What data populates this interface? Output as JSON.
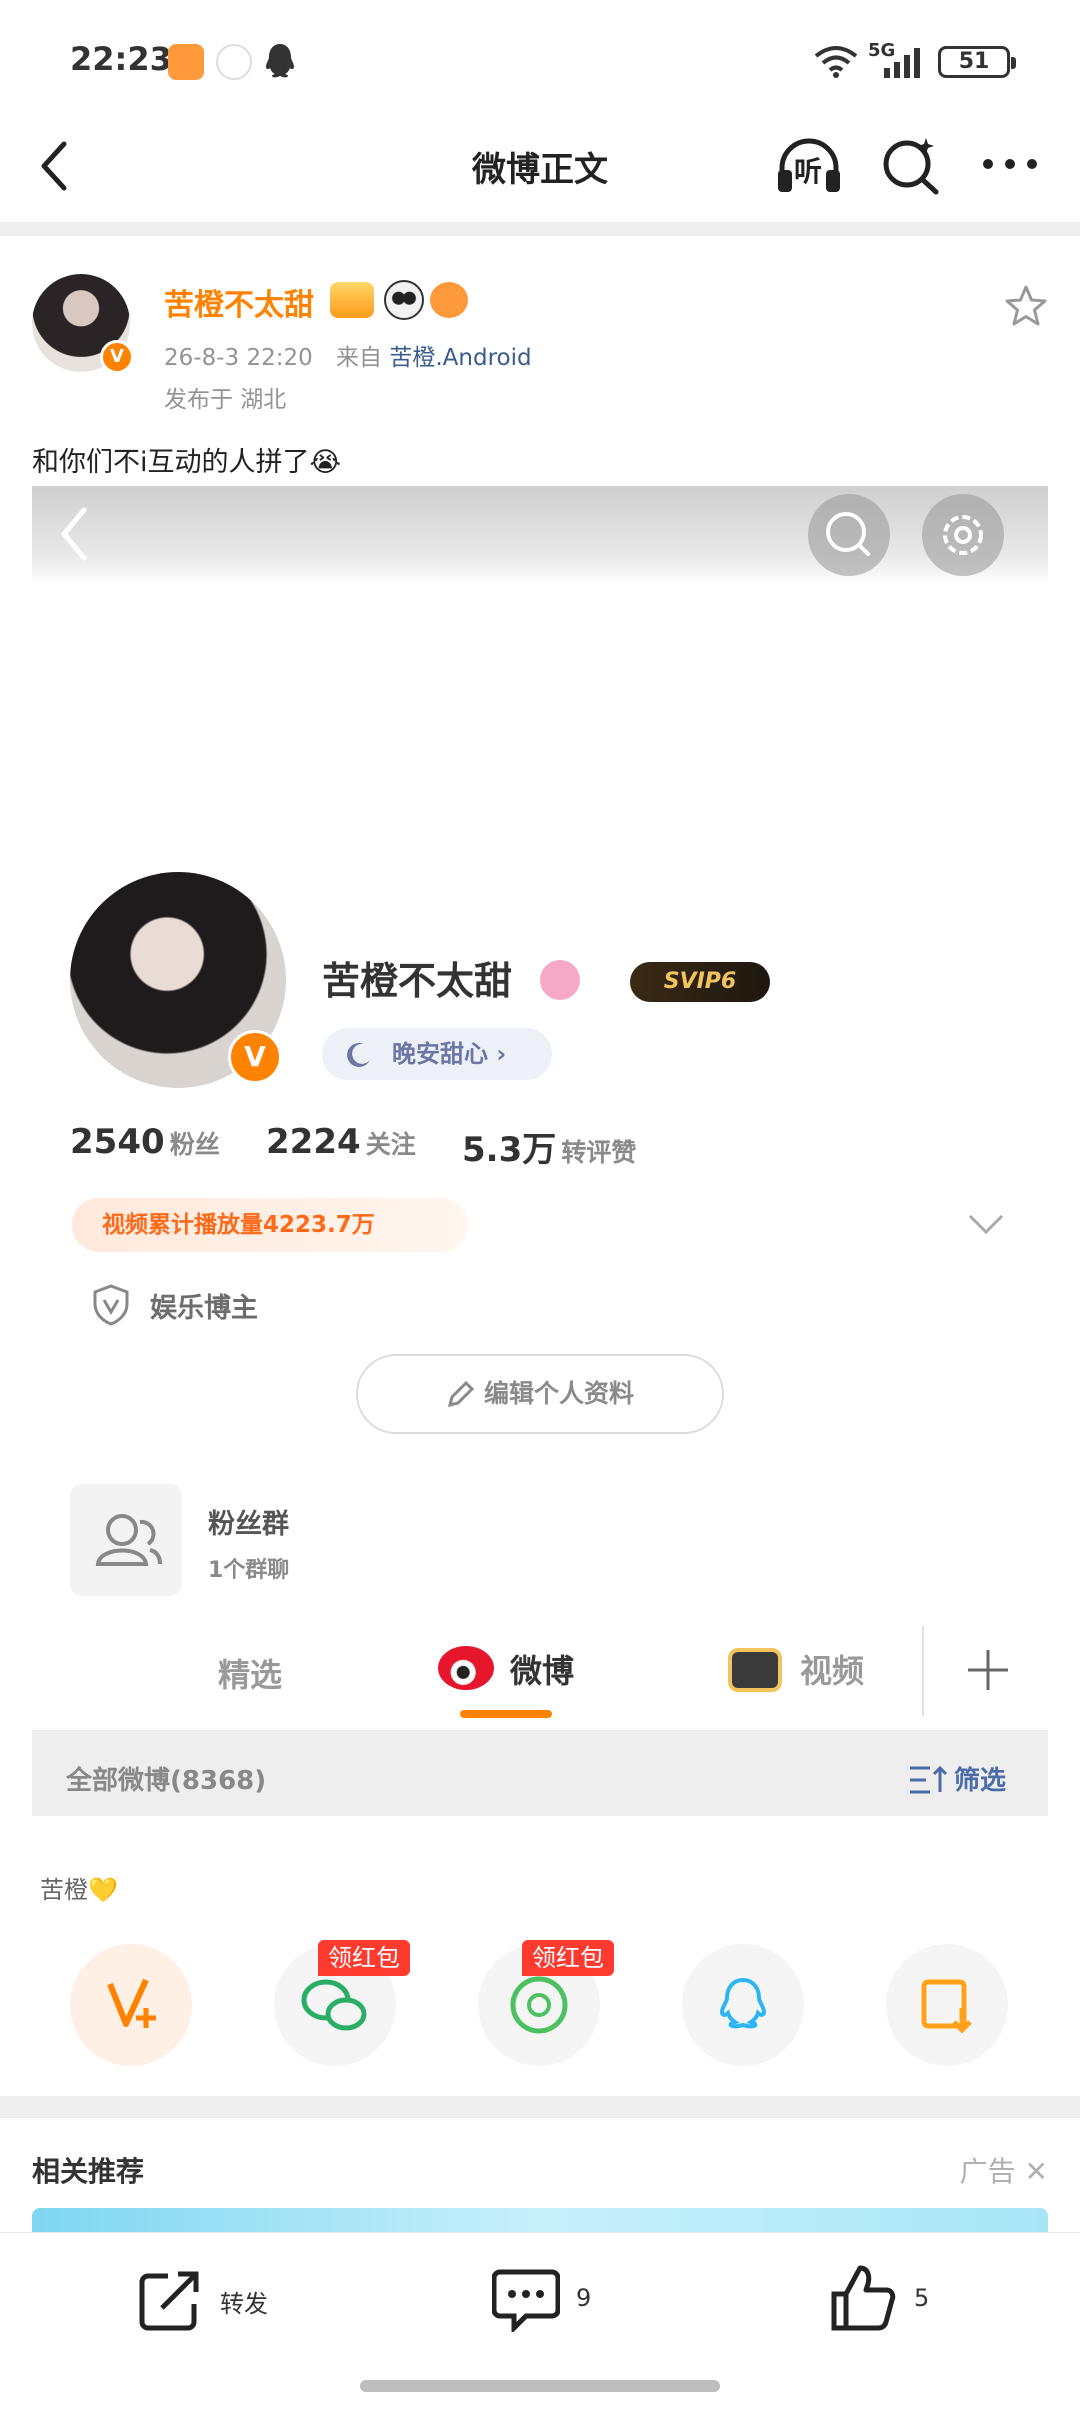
{
  "status_bar": {
    "time": "22:23",
    "network": "5G",
    "battery": "51",
    "icons": [
      "app-notification-icon",
      "weibo-small-icon",
      "qq-icon",
      "wifi-icon",
      "signal-icon",
      "battery-icon"
    ]
  },
  "header": {
    "title": "微博正文",
    "listen_label": "听",
    "icons": [
      "back-arrow-icon",
      "headphones-icon",
      "search-sparkle-icon",
      "more-dots-icon"
    ]
  },
  "post": {
    "author": "苦橙不太甜",
    "time": "26-8-3 22:20",
    "from_label": "来自",
    "source": "苦橙.Android",
    "location": "发布于 湖北",
    "text": "和你们不i互动的人拼了😭"
  },
  "embedded_profile": {
    "name": "苦橙不太甜",
    "svip": "SVIP6",
    "mood": "晚安甜心",
    "stats": [
      {
        "num": "2540",
        "label": "粉丝"
      },
      {
        "num": "2224",
        "label": "关注"
      },
      {
        "num": "5.3万",
        "label": "转评赞"
      }
    ],
    "views": "视频累计播放量4223.7万",
    "role": "娱乐博主",
    "edit_button": "编辑个人资料",
    "group_title": "粉丝群",
    "group_sub": "1个群聊",
    "tabs": [
      "精选",
      "微博",
      "视频"
    ],
    "all_weibo": "全部微博(8368)",
    "filter": "筛选"
  },
  "share": {
    "hint": "苦橙💛",
    "red_tag": "领红包",
    "targets": [
      "vplus-icon",
      "wechat-icon",
      "moments-icon",
      "qq-icon",
      "save-image-icon"
    ]
  },
  "related": {
    "title": "相关推荐",
    "ad": "广告"
  },
  "bottom_bar": {
    "repost": "转发",
    "comments": "9",
    "likes": "5"
  },
  "colors": {
    "accent": "#ff8200",
    "link": "#3a5c8c",
    "red_tag": "#ff3b30"
  }
}
